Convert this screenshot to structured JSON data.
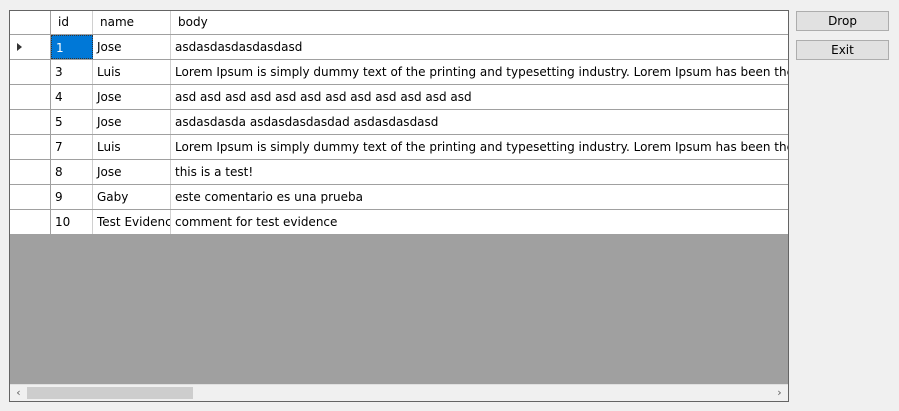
{
  "grid": {
    "columns": [
      "id",
      "name",
      "body"
    ],
    "rows": [
      {
        "id": "1",
        "name": "Jose",
        "body": "asdasdasdasdasdasd"
      },
      {
        "id": "3",
        "name": "Luis",
        "body": "Lorem Ipsum is simply dummy text of the printing and typesetting industry. Lorem Ipsum has been the industry's sta"
      },
      {
        "id": "4",
        "name": "Jose",
        "body": "asd asd asd asd asd asd asd asd asd asd asd asd"
      },
      {
        "id": "5",
        "name": "Jose",
        "body": "asdasdasda asdasdasdasdad asdasdasdasd"
      },
      {
        "id": "7",
        "name": "Luis",
        "body": "Lorem Ipsum is simply dummy text of the printing and typesetting industry. Lorem Ipsum has been the industry's sta"
      },
      {
        "id": "8",
        "name": "Jose",
        "body": "this is a test!"
      },
      {
        "id": "9",
        "name": "Gaby",
        "body": "este comentario es una prueba"
      },
      {
        "id": "10",
        "name": "Test Evidence",
        "body": "comment for test evidence"
      }
    ],
    "selected_row": 0
  },
  "buttons": {
    "drop": "Drop",
    "exit": "Exit"
  },
  "scrollbar": {
    "left_arrow": "‹",
    "right_arrow": "›"
  }
}
